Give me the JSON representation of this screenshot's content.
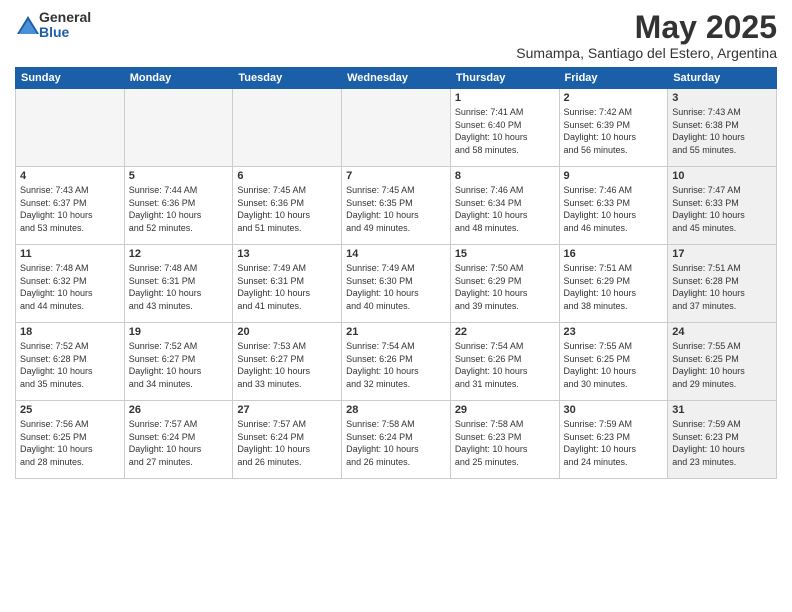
{
  "logo": {
    "text_general": "General",
    "text_blue": "Blue"
  },
  "title": "May 2025",
  "subtitle": "Sumampa, Santiago del Estero, Argentina",
  "headers": [
    "Sunday",
    "Monday",
    "Tuesday",
    "Wednesday",
    "Thursday",
    "Friday",
    "Saturday"
  ],
  "weeks": [
    [
      {
        "day": "",
        "info": "",
        "empty": true
      },
      {
        "day": "",
        "info": "",
        "empty": true
      },
      {
        "day": "",
        "info": "",
        "empty": true
      },
      {
        "day": "",
        "info": "",
        "empty": true
      },
      {
        "day": "1",
        "info": "Sunrise: 7:41 AM\nSunset: 6:40 PM\nDaylight: 10 hours\nand 58 minutes."
      },
      {
        "day": "2",
        "info": "Sunrise: 7:42 AM\nSunset: 6:39 PM\nDaylight: 10 hours\nand 56 minutes."
      },
      {
        "day": "3",
        "info": "Sunrise: 7:43 AM\nSunset: 6:38 PM\nDaylight: 10 hours\nand 55 minutes.",
        "shaded": true
      }
    ],
    [
      {
        "day": "4",
        "info": "Sunrise: 7:43 AM\nSunset: 6:37 PM\nDaylight: 10 hours\nand 53 minutes."
      },
      {
        "day": "5",
        "info": "Sunrise: 7:44 AM\nSunset: 6:36 PM\nDaylight: 10 hours\nand 52 minutes."
      },
      {
        "day": "6",
        "info": "Sunrise: 7:45 AM\nSunset: 6:36 PM\nDaylight: 10 hours\nand 51 minutes."
      },
      {
        "day": "7",
        "info": "Sunrise: 7:45 AM\nSunset: 6:35 PM\nDaylight: 10 hours\nand 49 minutes."
      },
      {
        "day": "8",
        "info": "Sunrise: 7:46 AM\nSunset: 6:34 PM\nDaylight: 10 hours\nand 48 minutes."
      },
      {
        "day": "9",
        "info": "Sunrise: 7:46 AM\nSunset: 6:33 PM\nDaylight: 10 hours\nand 46 minutes."
      },
      {
        "day": "10",
        "info": "Sunrise: 7:47 AM\nSunset: 6:33 PM\nDaylight: 10 hours\nand 45 minutes.",
        "shaded": true
      }
    ],
    [
      {
        "day": "11",
        "info": "Sunrise: 7:48 AM\nSunset: 6:32 PM\nDaylight: 10 hours\nand 44 minutes."
      },
      {
        "day": "12",
        "info": "Sunrise: 7:48 AM\nSunset: 6:31 PM\nDaylight: 10 hours\nand 43 minutes."
      },
      {
        "day": "13",
        "info": "Sunrise: 7:49 AM\nSunset: 6:31 PM\nDaylight: 10 hours\nand 41 minutes."
      },
      {
        "day": "14",
        "info": "Sunrise: 7:49 AM\nSunset: 6:30 PM\nDaylight: 10 hours\nand 40 minutes."
      },
      {
        "day": "15",
        "info": "Sunrise: 7:50 AM\nSunset: 6:29 PM\nDaylight: 10 hours\nand 39 minutes."
      },
      {
        "day": "16",
        "info": "Sunrise: 7:51 AM\nSunset: 6:29 PM\nDaylight: 10 hours\nand 38 minutes."
      },
      {
        "day": "17",
        "info": "Sunrise: 7:51 AM\nSunset: 6:28 PM\nDaylight: 10 hours\nand 37 minutes.",
        "shaded": true
      }
    ],
    [
      {
        "day": "18",
        "info": "Sunrise: 7:52 AM\nSunset: 6:28 PM\nDaylight: 10 hours\nand 35 minutes."
      },
      {
        "day": "19",
        "info": "Sunrise: 7:52 AM\nSunset: 6:27 PM\nDaylight: 10 hours\nand 34 minutes."
      },
      {
        "day": "20",
        "info": "Sunrise: 7:53 AM\nSunset: 6:27 PM\nDaylight: 10 hours\nand 33 minutes."
      },
      {
        "day": "21",
        "info": "Sunrise: 7:54 AM\nSunset: 6:26 PM\nDaylight: 10 hours\nand 32 minutes."
      },
      {
        "day": "22",
        "info": "Sunrise: 7:54 AM\nSunset: 6:26 PM\nDaylight: 10 hours\nand 31 minutes."
      },
      {
        "day": "23",
        "info": "Sunrise: 7:55 AM\nSunset: 6:25 PM\nDaylight: 10 hours\nand 30 minutes."
      },
      {
        "day": "24",
        "info": "Sunrise: 7:55 AM\nSunset: 6:25 PM\nDaylight: 10 hours\nand 29 minutes.",
        "shaded": true
      }
    ],
    [
      {
        "day": "25",
        "info": "Sunrise: 7:56 AM\nSunset: 6:25 PM\nDaylight: 10 hours\nand 28 minutes."
      },
      {
        "day": "26",
        "info": "Sunrise: 7:57 AM\nSunset: 6:24 PM\nDaylight: 10 hours\nand 27 minutes."
      },
      {
        "day": "27",
        "info": "Sunrise: 7:57 AM\nSunset: 6:24 PM\nDaylight: 10 hours\nand 26 minutes."
      },
      {
        "day": "28",
        "info": "Sunrise: 7:58 AM\nSunset: 6:24 PM\nDaylight: 10 hours\nand 26 minutes."
      },
      {
        "day": "29",
        "info": "Sunrise: 7:58 AM\nSunset: 6:23 PM\nDaylight: 10 hours\nand 25 minutes."
      },
      {
        "day": "30",
        "info": "Sunrise: 7:59 AM\nSunset: 6:23 PM\nDaylight: 10 hours\nand 24 minutes."
      },
      {
        "day": "31",
        "info": "Sunrise: 7:59 AM\nSunset: 6:23 PM\nDaylight: 10 hours\nand 23 minutes.",
        "shaded": true
      }
    ]
  ]
}
